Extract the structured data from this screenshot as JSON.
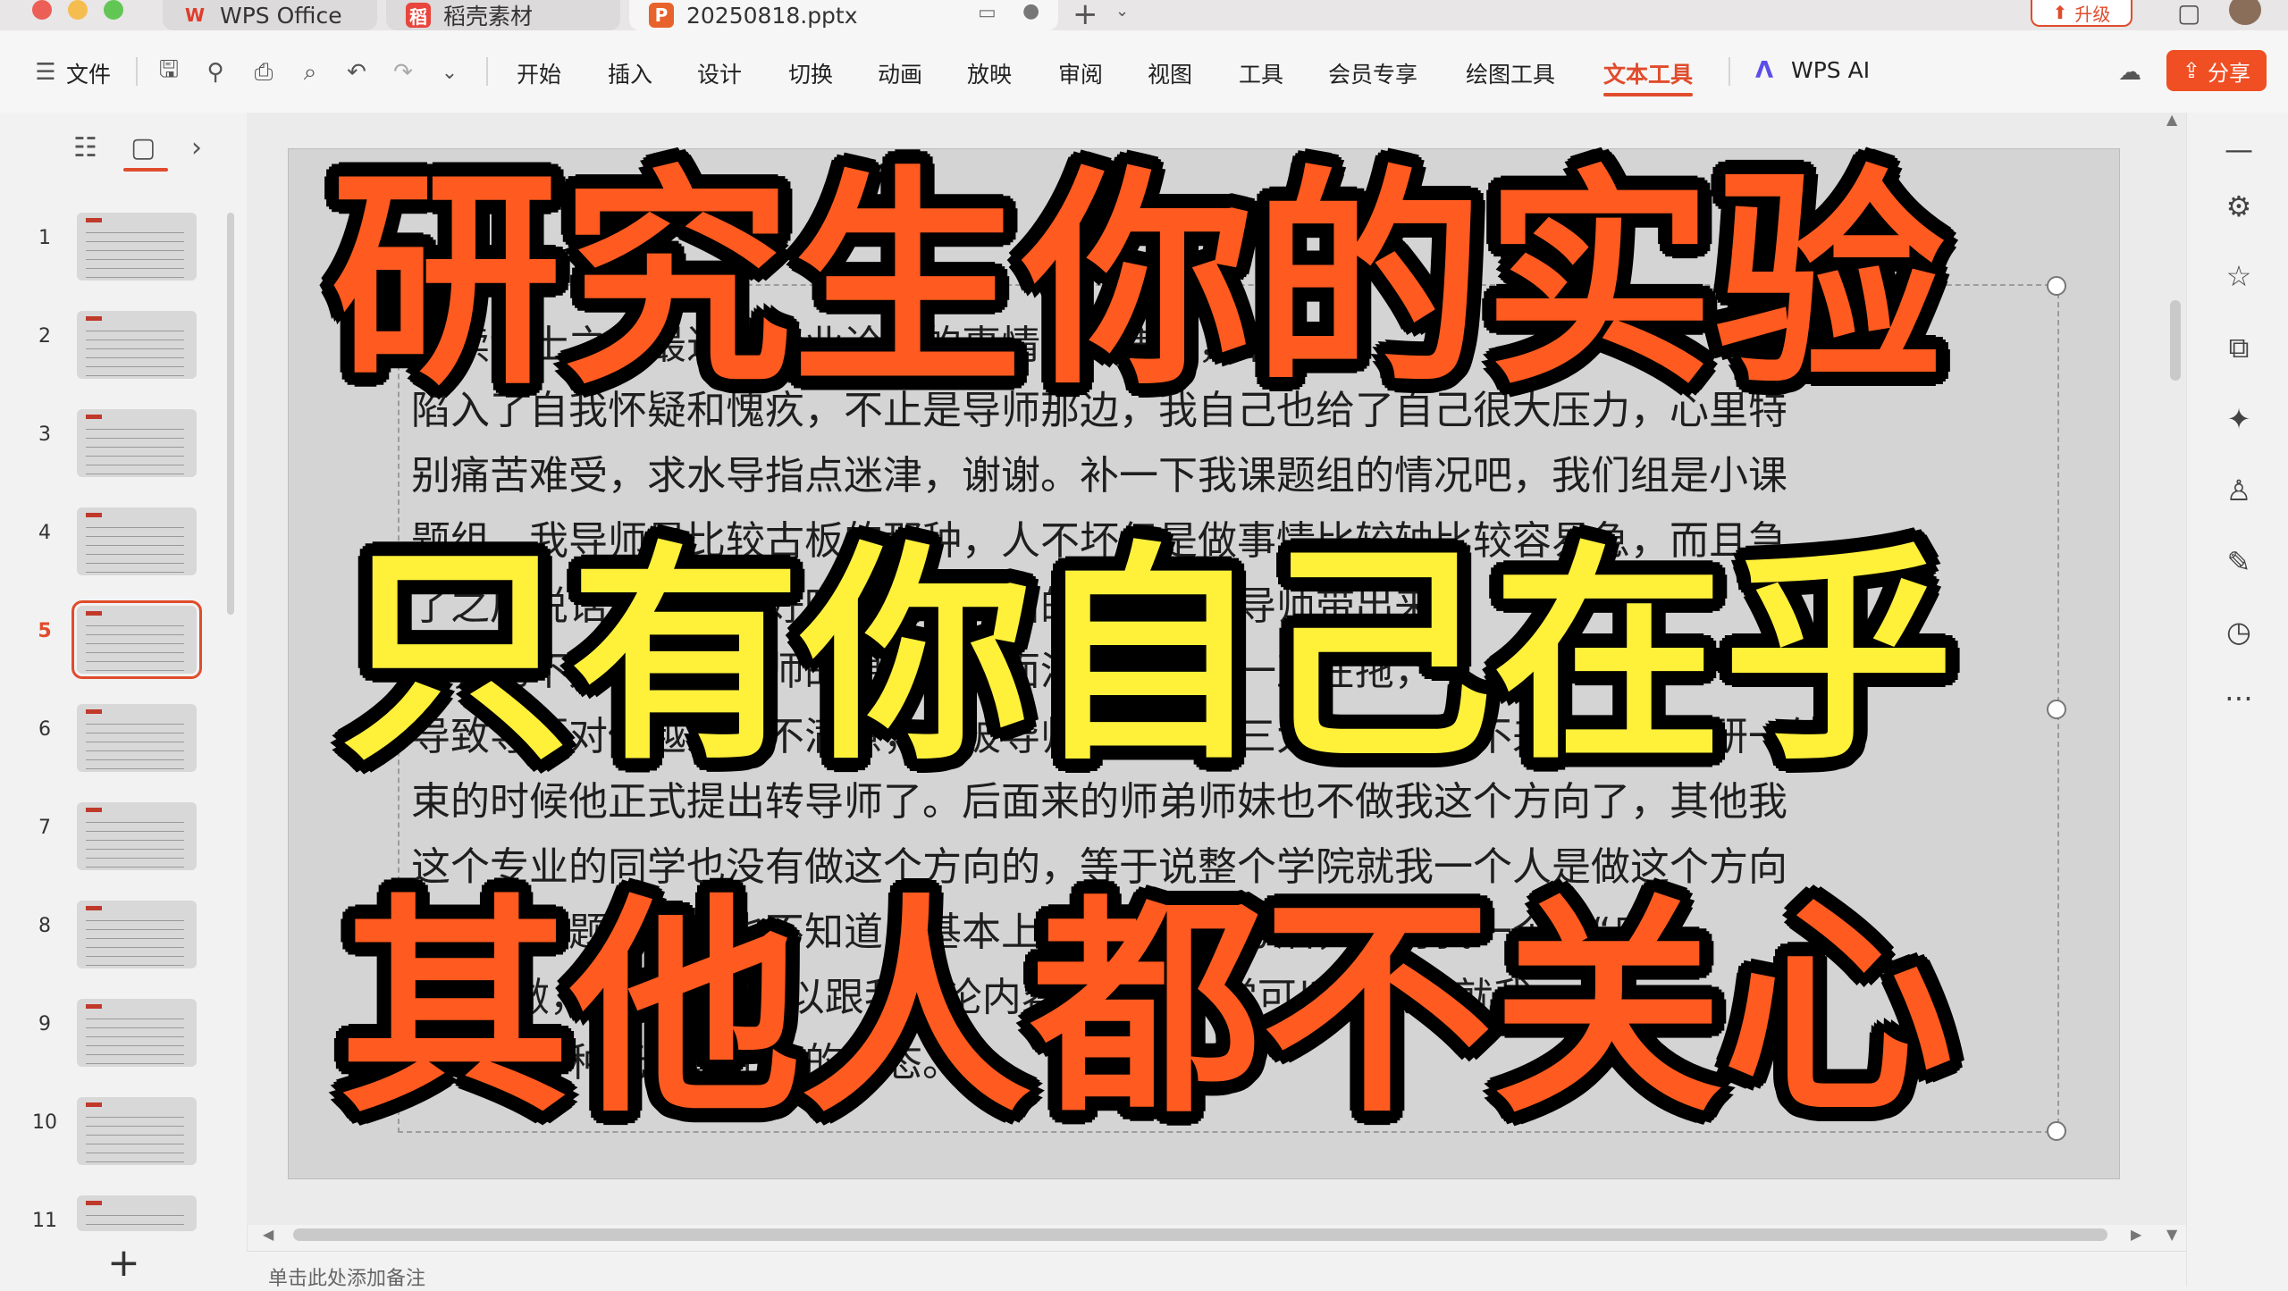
{
  "tabs": [
    {
      "label": "WPS Office",
      "icon": "wps-logo-icon"
    },
    {
      "label": "稻壳素材",
      "icon": "docer-icon"
    },
    {
      "label": "20250818.pptx",
      "icon": "presentation-file-icon"
    }
  ],
  "upgrade_label": "升级",
  "menu": {
    "file_label": "文件",
    "items": [
      "开始",
      "插入",
      "设计",
      "切换",
      "动画",
      "放映",
      "审阅",
      "视图",
      "工具",
      "会员专享",
      "绘图工具",
      "文本工具"
    ],
    "active": "文本工具",
    "ai_label": "WPS AI",
    "share_label": "分享"
  },
  "thumbnails": [
    {
      "num": "1"
    },
    {
      "num": "2"
    },
    {
      "num": "3"
    },
    {
      "num": "4"
    },
    {
      "num": "5",
      "selected": true
    },
    {
      "num": "6"
    },
    {
      "num": "7"
    },
    {
      "num": "8"
    },
    {
      "num": "9"
    },
    {
      "num": "10"
    },
    {
      "num": "11"
    }
  ],
  "slide": {
    "body_lines": [
      "在读博士之，最近因毕业论文的事情非常焦虑，最近又",
      "陷入了自我怀疑和愧疚，不止是导师那边，我自己也给了自己很大压力，心里特",
      "别痛苦难受，求水导指点迷津，谢谢。补一下我课题组的情况吧，我们组是小课",
      "题组，我导师是比较古板的那种，人不坏但是做事情比较轴比较容易急，而且急",
      "了之后说话就有点不好听，大我三届的师兄也是导师带出来",
      "的，也不太了解我导师的想法，后面没做，而且一直在拖，",
      "导致导师对他越来越不满意，他被导师骂了之后三大基本上就不来了，在我研一结",
      "束的时候他正式提出转导师了。后面来的师弟师妹也不做我这个方向了，其他我",
      "这个专业的同学也没有做这个方向的，等于说整个学院就我一个人是做这个方向",
      "的，有问题问老师也不知道，基本上是我自己在琢磨，只有我一个人“自",
      "己”在做，也没有人可以跟我讨论内容，没有同学可以交流，就我",
      "一个人一种无力感无助的状态。"
    ],
    "overlay_lines": [
      {
        "text": "研究生你的实验",
        "color": "#ff5a1f"
      },
      {
        "text": "只有你自己在乎",
        "color": "#fff03a"
      },
      {
        "text": "其他人都不关心",
        "color": "#ff5a1f"
      }
    ]
  },
  "notes_placeholder": "单击此处添加备注",
  "colors": {
    "accent": "#e04c2c",
    "share_bg": "#f04e23"
  }
}
